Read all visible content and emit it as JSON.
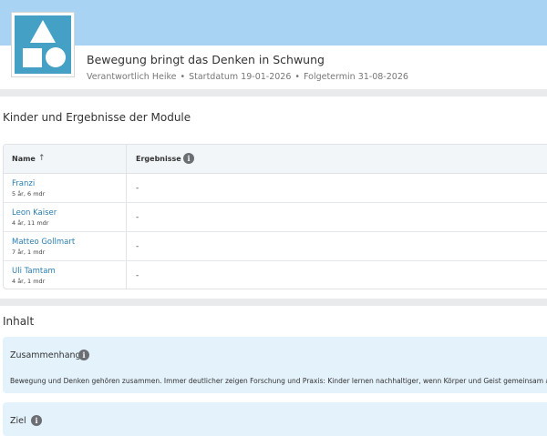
{
  "project": {
    "title": "Bewegung bringt das Denken in Schwung",
    "meta": {
      "responsible": "Verantwortlich Heike",
      "start": "Startdatum 19-01-2026",
      "followup": "Folgetermin 31-08-2026"
    }
  },
  "results_section": {
    "title": "Kinder und Ergebnisse der Module",
    "columns": {
      "name": "Name",
      "results": "Ergebnisse"
    },
    "rows": [
      {
        "name": "Franzi",
        "age": "5 år, 6 mdr",
        "result": "-"
      },
      {
        "name": "Leon Kaiser",
        "age": "4 år, 11 mdr",
        "result": "-"
      },
      {
        "name": "Matteo Gollmart",
        "age": "7 år, 1 mdr",
        "result": "-"
      },
      {
        "name": "Uli Tamtam",
        "age": "4 år, 1 mdr",
        "result": "-"
      }
    ]
  },
  "content_section": {
    "title": "Inhalt",
    "cards": [
      {
        "title": "Zusammenhang",
        "text": "Bewegung und Denken gehören zusammen. Immer deutlicher zeigen Forschung und Praxis: Kinder lernen nachhaltiger, wenn Körper und Geist gemeinsam aktiv s"
      },
      {
        "title": "Ziel"
      }
    ]
  },
  "colors": {
    "hero": "#a9d3f3",
    "logo": "#44a0c4",
    "link": "#2a7db0",
    "card": "#e4f2fb"
  },
  "icons": {
    "logo": "shapes-logo-icon",
    "sort": "arrow-up-icon",
    "info": "info-icon"
  }
}
